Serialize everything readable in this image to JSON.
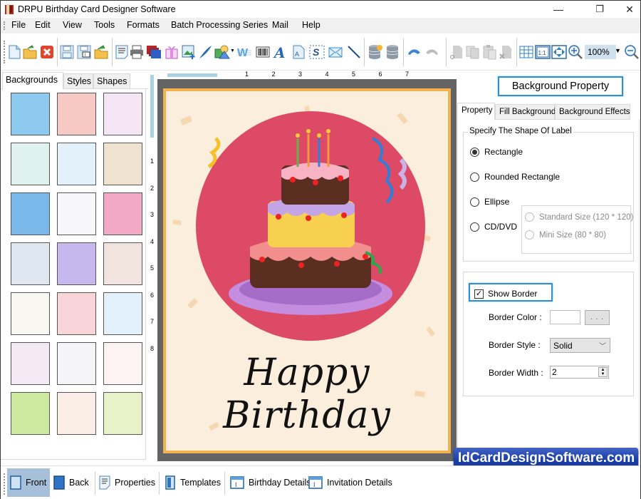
{
  "window": {
    "title": "DRPU Birthday Card Designer Software",
    "controls": {
      "minimize": "—",
      "maximize": "❐",
      "close": "✕"
    }
  },
  "menu": [
    "File",
    "Edit",
    "View",
    "Tools",
    "Formats",
    "Batch Processing Series",
    "Mail",
    "Help"
  ],
  "toolbar": {
    "icons": [
      "new-icon",
      "open-icon",
      "close-icon",
      "save-icon",
      "save-as-icon",
      "export-icon",
      "properties-icon",
      "print-icon",
      "layers-icon",
      "gift-icon",
      "insert-image-icon",
      "signature-pen-icon",
      "shapes-icon",
      "watermark-icon",
      "barcode-icon",
      "text-icon",
      "text-file-icon",
      "select-text-icon",
      "mail-icon",
      "line-icon",
      "database-add-icon",
      "database-icon",
      "undo-icon",
      "redo-icon",
      "cut-icon",
      "copy-icon",
      "paste-icon",
      "delete-icon",
      "grid-icon",
      "actual-size-icon",
      "fit-window-icon",
      "zoom-in-icon"
    ],
    "zoom_value": "100%",
    "zoom_out_icon": "zoom-out-icon"
  },
  "left_panel": {
    "tabs": [
      "Backgrounds",
      "Styles",
      "Shapes"
    ],
    "active_tab": "Backgrounds",
    "thumbnails": [
      {
        "name": "clouds",
        "color": "#8ec9ef"
      },
      {
        "name": "pink-pattern",
        "color": "#f7c9c4"
      },
      {
        "name": "butterflies",
        "color": "#f5e6f5"
      },
      {
        "name": "daisies",
        "color": "#dff2ee"
      },
      {
        "name": "pastel-toys",
        "color": "#e3f1fa"
      },
      {
        "name": "balloons-beige",
        "color": "#efe3d0"
      },
      {
        "name": "stars",
        "color": "#7ab8ea"
      },
      {
        "name": "balloons-white",
        "color": "#f7f7fb"
      },
      {
        "name": "cakes-pink",
        "color": "#f2a9c3"
      },
      {
        "name": "bubbles",
        "color": "#dfe7f1"
      },
      {
        "name": "rainbow",
        "color": "#c6b7ec"
      },
      {
        "name": "teddy",
        "color": "#f1e4df"
      },
      {
        "name": "happy-birthday",
        "color": "#f9f7f2"
      },
      {
        "name": "hearts-pink",
        "color": "#f9d4d8"
      },
      {
        "name": "balloons-sky",
        "color": "#e2f1fb"
      },
      {
        "name": "hearts-outline",
        "color": "#f6e9f6"
      },
      {
        "name": "balloon-bunches",
        "color": "#f5f5f8"
      },
      {
        "name": "red-hearts",
        "color": "#fdf3f3"
      },
      {
        "name": "green-stripes",
        "color": "#cdeaa0"
      },
      {
        "name": "cakes-pattern",
        "color": "#fbeee6"
      },
      {
        "name": "garden",
        "color": "#e8f1c8"
      }
    ]
  },
  "rulers": {
    "horizontal": [
      "1",
      "2",
      "3",
      "4",
      "5",
      "6",
      "7"
    ],
    "vertical": [
      "1",
      "2",
      "3",
      "4",
      "5",
      "6",
      "7",
      "8"
    ]
  },
  "card": {
    "title": "Happy Birthday",
    "image": "birthday-cake-illustration",
    "border_color": "#f3b24e",
    "background_color": "#fbeedd",
    "circle_color": "#dc4a66"
  },
  "right_panel": {
    "header": "Background Property",
    "tabs": [
      "Property",
      "Fill Background",
      "Background Effects"
    ],
    "active_tab": "Property",
    "shape_group": {
      "legend": "Specify The Shape Of Label",
      "options": [
        {
          "label": "Rectangle",
          "selected": true
        },
        {
          "label": "Rounded Rectangle",
          "selected": false
        },
        {
          "label": "Ellipse",
          "selected": false
        },
        {
          "label": "CD/DVD",
          "selected": false
        }
      ],
      "cd_sizes": [
        {
          "label": "Standard Size (120 * 120)",
          "enabled": false
        },
        {
          "label": "Mini Size (80 * 80)",
          "enabled": false
        }
      ]
    },
    "border_group": {
      "show_border_label": "Show Border",
      "show_border_checked": true,
      "border_color_label": "Border Color :",
      "border_color_value": "#ffffff",
      "browse_label": ". . .",
      "border_style_label": "Border Style :",
      "border_style_value": "Solid",
      "border_width_label": "Border Width :",
      "border_width_value": "2"
    }
  },
  "bottom_tabs": [
    {
      "label": "Front",
      "icon": "front-page-icon",
      "active": true
    },
    {
      "label": "Back",
      "icon": "back-page-icon",
      "active": false
    },
    {
      "label": "Properties",
      "icon": "properties-icon",
      "active": false
    },
    {
      "label": "Templates",
      "icon": "templates-icon",
      "active": false
    },
    {
      "label": "Birthday Details",
      "icon": "details-form-icon",
      "active": false
    },
    {
      "label": "Invitation Details",
      "icon": "details-form-icon",
      "active": false
    }
  ],
  "brand_banner": "IdCardDesignSoftware.com"
}
